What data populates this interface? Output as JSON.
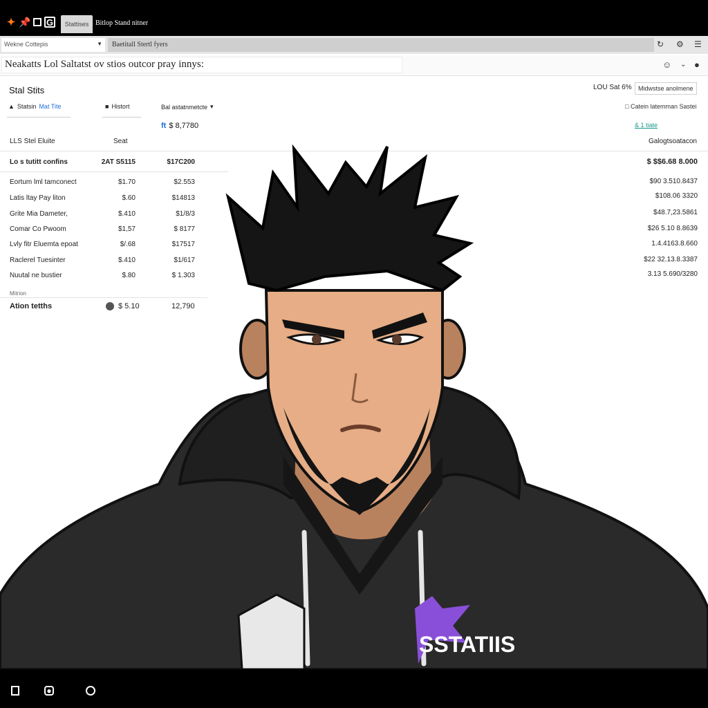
{
  "browser": {
    "tabs": [
      {
        "label": "Stattises",
        "active": true
      },
      {
        "label": "Bitlop Stand nitner",
        "active": false
      }
    ],
    "address_left": "Wekne Cottepis",
    "address_url": "Baetitall Stertl fyers",
    "search_text": "Neakatts Lol Saltatst ov stios outcor pray innys:",
    "icons": [
      "flame-icon",
      "pin-icon",
      "square-icon",
      "g-icon",
      "refresh-icon",
      "extension-icon",
      "menu-icon",
      "user-icon",
      "chevron-down-icon",
      "account-icon"
    ]
  },
  "panel": {
    "title": "Stal Stits",
    "nav_item_1": {
      "text": "Statsin",
      "blue": "Mat Tite"
    },
    "nav_item_2": "Histort",
    "dropdown_label": "Bal astatnmetcte",
    "summary_icon": "ft",
    "summary_value": "$ 8,7780",
    "col_header_1": "LLS Stel Eluite",
    "col_header_2": "Seat",
    "total_row": {
      "label": "Lo s tutitt confins",
      "c2": "2AT S5115",
      "c3": "$17C200"
    },
    "rows": [
      {
        "label": "Eortum lml tamconect",
        "c2": "$1.70",
        "c3": "$2.553"
      },
      {
        "label": "Latis ltay Pay liton",
        "c2": "$.60",
        "c3": "$14813"
      },
      {
        "label": "Grite Mia Dameter,",
        "c2": "$.410",
        "c3": "$1/8/3"
      },
      {
        "label": "Comar Co Pwoom",
        "c2": "$1,57",
        "c3": "$ 8177"
      },
      {
        "label": "Lvly fitr Eluemta epoat",
        "c2": "$/.68",
        "c3": "$17517"
      },
      {
        "label": "Raclerel Tuesinter",
        "c2": "$.410",
        "c3": "$1/617"
      },
      {
        "label": "Nuutal ne bustier",
        "c2": "$.80",
        "c3": "$ 1.303"
      }
    ],
    "foot_small": "Mitrion",
    "foot_row": {
      "label": "Ation tetths",
      "c2": "$ 5.10",
      "c3": "12,790"
    }
  },
  "right": {
    "top_label": "LOU Sat 6%",
    "select_value": "Midwstse anolmene",
    "tool_label": "Catein latemman Sastei",
    "link": "& 1 tiate",
    "col_header": "Galogtsoatacon",
    "total_value": "$ $$6.68 8.000",
    "values": [
      "$90 3.510.8437",
      "$108.06 3320",
      "$48.7,23.5861",
      "$26 5.10 8.8639",
      "1.4.4163.8.660",
      "$22 32.13.8.3387",
      "3.13 5.690/3280"
    ]
  },
  "hoodie_text": "SSTATIIS",
  "bottom_icons": [
    "document-icon",
    "camera-icon",
    "clock-icon"
  ]
}
